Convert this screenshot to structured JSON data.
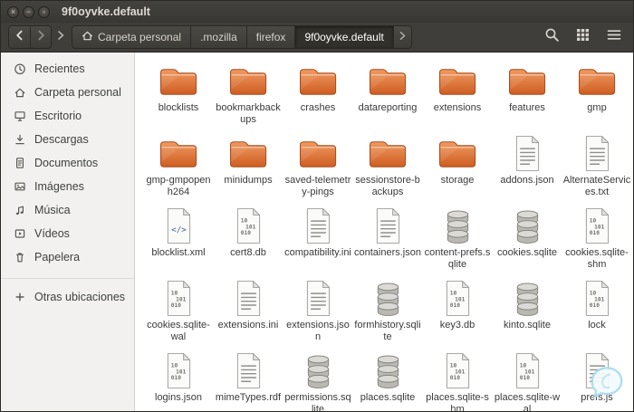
{
  "window": {
    "title": "9f0oyvke.default",
    "controls": [
      "close",
      "minimize",
      "maximize"
    ]
  },
  "toolbar": {
    "breadcrumbs": [
      {
        "label": "Carpeta personal",
        "icon": "home",
        "active": false
      },
      {
        "label": ".mozilla",
        "active": false
      },
      {
        "label": "firefox",
        "active": false
      },
      {
        "label": "9f0oyvke.default",
        "active": true
      }
    ],
    "icons": [
      "back",
      "forward",
      "path-chevron",
      "search",
      "view-grid",
      "menu"
    ]
  },
  "sidebar": {
    "items": [
      {
        "label": "Recientes",
        "icon": "recent"
      },
      {
        "label": "Carpeta personal",
        "icon": "home"
      },
      {
        "label": "Escritorio",
        "icon": "desktop"
      },
      {
        "label": "Descargas",
        "icon": "downloads"
      },
      {
        "label": "Documentos",
        "icon": "documents"
      },
      {
        "label": "Imágenes",
        "icon": "pictures"
      },
      {
        "label": "Música",
        "icon": "music"
      },
      {
        "label": "Vídeos",
        "icon": "videos"
      },
      {
        "label": "Papelera",
        "icon": "trash"
      }
    ],
    "footer": {
      "label": "Otras ubicaciones",
      "icon": "plus"
    }
  },
  "files": [
    {
      "name": "blocklists",
      "type": "folder"
    },
    {
      "name": "bookmarkbackups",
      "type": "folder"
    },
    {
      "name": "crashes",
      "type": "folder"
    },
    {
      "name": "datareporting",
      "type": "folder"
    },
    {
      "name": "extensions",
      "type": "folder"
    },
    {
      "name": "features",
      "type": "folder"
    },
    {
      "name": "gmp",
      "type": "folder"
    },
    {
      "name": "gmp-gmpopenh264",
      "type": "folder"
    },
    {
      "name": "minidumps",
      "type": "folder"
    },
    {
      "name": "saved-telemetry-pings",
      "type": "folder"
    },
    {
      "name": "sessionstore-backups",
      "type": "folder"
    },
    {
      "name": "storage",
      "type": "folder"
    },
    {
      "name": "addons.json",
      "type": "text"
    },
    {
      "name": "AlternateServices.txt",
      "type": "text"
    },
    {
      "name": "blocklist.xml",
      "type": "code"
    },
    {
      "name": "cert8.db",
      "type": "binary"
    },
    {
      "name": "compatibility.ini",
      "type": "text"
    },
    {
      "name": "containers.json",
      "type": "text"
    },
    {
      "name": "content-prefs.sqlite",
      "type": "database"
    },
    {
      "name": "cookies.sqlite",
      "type": "database"
    },
    {
      "name": "cookies.sqlite-shm",
      "type": "binary"
    },
    {
      "name": "cookies.sqlite-wal",
      "type": "binary"
    },
    {
      "name": "extensions.ini",
      "type": "text"
    },
    {
      "name": "extensions.json",
      "type": "text"
    },
    {
      "name": "formhistory.sqlite",
      "type": "database"
    },
    {
      "name": "key3.db",
      "type": "binary"
    },
    {
      "name": "kinto.sqlite",
      "type": "database"
    },
    {
      "name": "lock",
      "type": "binary"
    },
    {
      "name": "logins.json",
      "type": "binary"
    },
    {
      "name": "mimeTypes.rdf",
      "type": "text"
    },
    {
      "name": "permissions.sqlite",
      "type": "database"
    },
    {
      "name": "places.sqlite",
      "type": "database"
    },
    {
      "name": "places.sqlite-shm",
      "type": "binary"
    },
    {
      "name": "places.sqlite-wal",
      "type": "binary"
    },
    {
      "name": "prefs.js",
      "type": "text"
    }
  ],
  "colors": {
    "titlebar_bg": "#44423e",
    "toolbar_bg": "#403e3a",
    "sidebar_bg": "#f2f1ef",
    "folder_orange_top": "#f09a60",
    "folder_orange_bottom": "#ce5d22",
    "folder_outline": "#a84d1c",
    "watermark_blue": "#a8dbee"
  }
}
